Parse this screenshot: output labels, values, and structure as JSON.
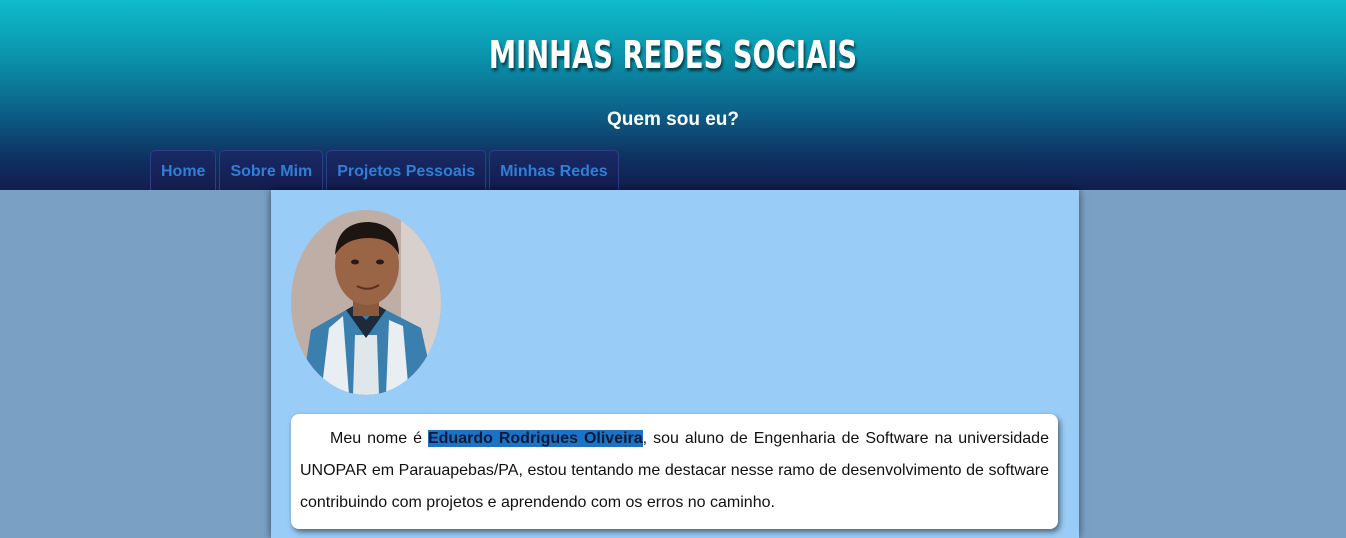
{
  "header": {
    "title": "MINHAS REDES SOCIAIS",
    "subtitle": "Quem sou eu?"
  },
  "nav": {
    "items": [
      {
        "label": "Home"
      },
      {
        "label": "Sobre Mim"
      },
      {
        "label": "Projetos Pessoais"
      },
      {
        "label": "Minhas Redes"
      }
    ]
  },
  "bio": {
    "prefix": "Meu nome é ",
    "name": "Eduardo Rodrigues Oliveira",
    "suffix": ", sou aluno de Engenharia de Software na universidade UNOPAR em Parauapebas/PA, estou tentando me destacar nesse ramo de desenvolvimento de software contribuindo com projetos e aprendendo com os erros no caminho."
  },
  "colors": {
    "page_background": "#7aa1c4",
    "content_background": "#99ccf7",
    "nav_text": "#2f7fd6",
    "highlight": "#1b73c7"
  }
}
